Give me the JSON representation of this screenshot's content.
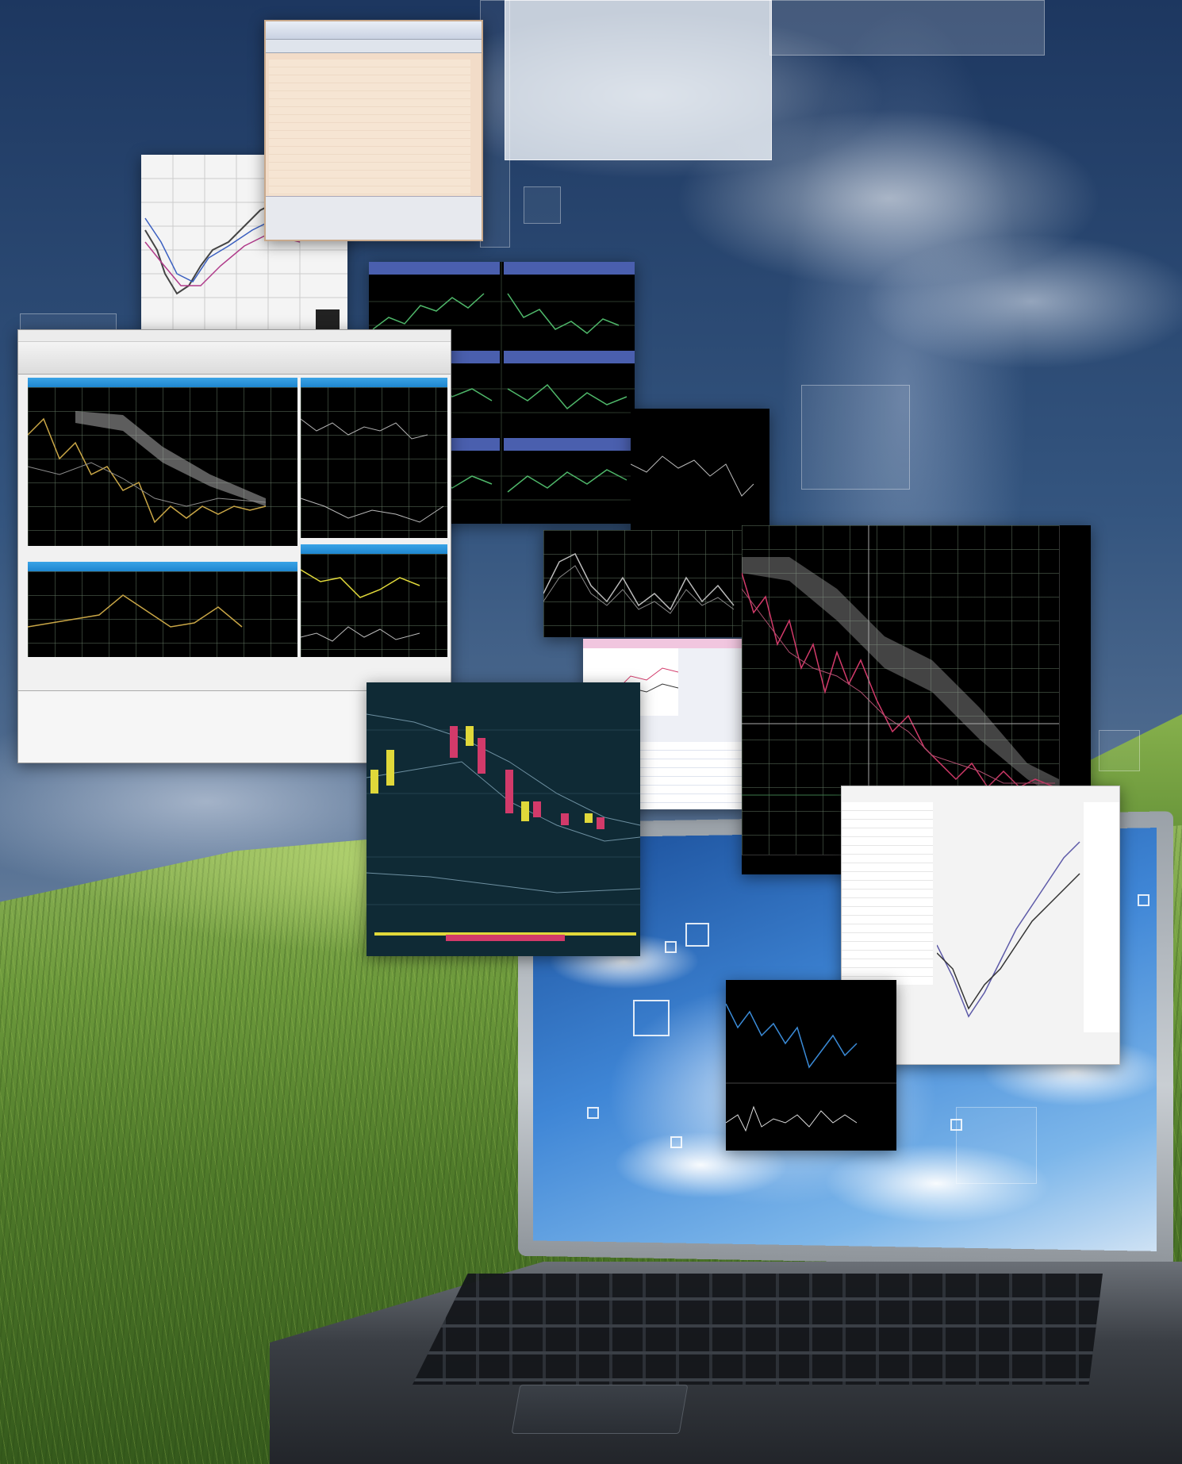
{
  "scene": {
    "description_tags": [
      "sky-background",
      "grass-field",
      "laptop",
      "floating-trading-windows"
    ],
    "colors": {
      "sky_top": "#1d3760",
      "grass": "#6d9a3c",
      "chart_background": "#000000",
      "line_gold": "#c9a646",
      "line_green": "#4fb86a",
      "candle_red": "#d23a6a",
      "candle_yellow": "#e0d83a",
      "window_title_blue": "#1f86cf"
    }
  }
}
